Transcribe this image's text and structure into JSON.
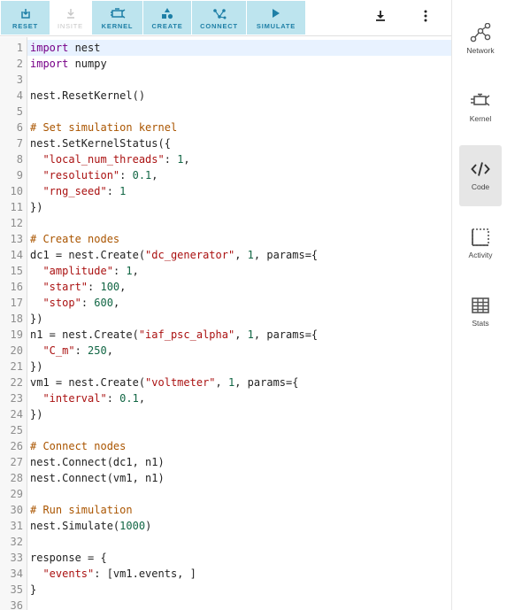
{
  "toolbar": {
    "buttons": [
      {
        "label": "RESET",
        "icon": "reset-icon",
        "enabled": true
      },
      {
        "label": "INSITE",
        "icon": "insite-icon",
        "enabled": false
      },
      {
        "label": "KERNEL",
        "icon": "kernel-icon",
        "enabled": true
      },
      {
        "label": "CREATE",
        "icon": "create-icon",
        "enabled": true
      },
      {
        "label": "CONNECT",
        "icon": "connect-icon",
        "enabled": true
      },
      {
        "label": "SIMULATE",
        "icon": "play-icon",
        "enabled": true
      }
    ],
    "download_icon": "download-icon",
    "menu_icon": "more-vert-icon"
  },
  "sidebar": {
    "items": [
      {
        "label": "Network",
        "icon": "network-icon",
        "active": false
      },
      {
        "label": "Kernel",
        "icon": "kernel-icon",
        "active": false
      },
      {
        "label": "Code",
        "icon": "code-icon",
        "active": true
      },
      {
        "label": "Activity",
        "icon": "activity-icon",
        "active": false
      },
      {
        "label": "Stats",
        "icon": "table-icon",
        "active": false
      }
    ]
  },
  "editor": {
    "active_line": 1,
    "lines": [
      {
        "n": "1",
        "text": "import nest"
      },
      {
        "n": "2",
        "text": "import numpy"
      },
      {
        "n": "3",
        "text": ""
      },
      {
        "n": "4",
        "text": "nest.ResetKernel()"
      },
      {
        "n": "5",
        "text": ""
      },
      {
        "n": "6",
        "text": "# Set simulation kernel"
      },
      {
        "n": "7",
        "text": "nest.SetKernelStatus({"
      },
      {
        "n": "8",
        "text": "  \"local_num_threads\": 1,"
      },
      {
        "n": "9",
        "text": "  \"resolution\": 0.1,"
      },
      {
        "n": "10",
        "text": "  \"rng_seed\": 1"
      },
      {
        "n": "11",
        "text": "})"
      },
      {
        "n": "12",
        "text": ""
      },
      {
        "n": "13",
        "text": "# Create nodes"
      },
      {
        "n": "14",
        "text": "dc1 = nest.Create(\"dc_generator\", 1, params={"
      },
      {
        "n": "15",
        "text": "  \"amplitude\": 1,"
      },
      {
        "n": "16",
        "text": "  \"start\": 100,"
      },
      {
        "n": "17",
        "text": "  \"stop\": 600,"
      },
      {
        "n": "18",
        "text": "})"
      },
      {
        "n": "19",
        "text": "n1 = nest.Create(\"iaf_psc_alpha\", 1, params={"
      },
      {
        "n": "20",
        "text": "  \"C_m\": 250,"
      },
      {
        "n": "21",
        "text": "})"
      },
      {
        "n": "22",
        "text": "vm1 = nest.Create(\"voltmeter\", 1, params={"
      },
      {
        "n": "23",
        "text": "  \"interval\": 0.1,"
      },
      {
        "n": "24",
        "text": "})"
      },
      {
        "n": "25",
        "text": ""
      },
      {
        "n": "26",
        "text": "# Connect nodes"
      },
      {
        "n": "27",
        "text": "nest.Connect(dc1, n1)"
      },
      {
        "n": "28",
        "text": "nest.Connect(vm1, n1)"
      },
      {
        "n": "29",
        "text": ""
      },
      {
        "n": "30",
        "text": "# Run simulation"
      },
      {
        "n": "31",
        "text": "nest.Simulate(1000)"
      },
      {
        "n": "32",
        "text": ""
      },
      {
        "n": "33",
        "text": "response = {"
      },
      {
        "n": "34",
        "text": "  \"events\": [vm1.events, ]"
      },
      {
        "n": "35",
        "text": "}"
      },
      {
        "n": "36",
        "text": ""
      }
    ]
  }
}
